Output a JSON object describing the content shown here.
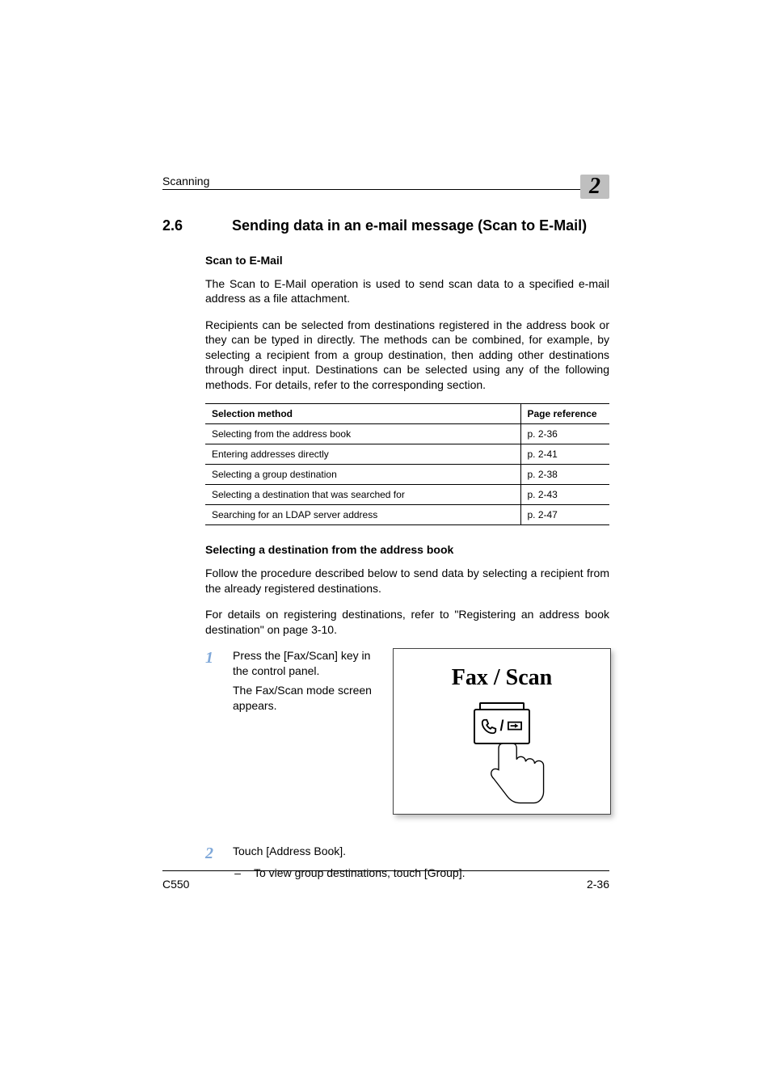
{
  "running_header": {
    "text": "Scanning",
    "chapter_number": "2"
  },
  "section": {
    "number": "2.6",
    "title": "Sending data in an e-mail message (Scan to E-Mail)"
  },
  "subsection1": {
    "heading": "Scan to E-Mail",
    "para1": "The Scan to E-Mail operation is used to send scan data to a specified e-mail address as a file attachment.",
    "para2": "Recipients can be selected from destinations registered in the address book or they can be typed in directly. The methods can be combined, for example, by selecting a recipient from a group destination, then adding other destinations through direct input. Destinations can be selected using any of the following methods. For details, refer to the corresponding section."
  },
  "table": {
    "header": {
      "col1": "Selection method",
      "col2": "Page reference"
    },
    "rows": [
      {
        "method": "Selecting from the address book",
        "page": "p. 2-36"
      },
      {
        "method": "Entering addresses directly",
        "page": "p. 2-41"
      },
      {
        "method": "Selecting a group destination",
        "page": "p. 2-38"
      },
      {
        "method": "Selecting a destination that was searched for",
        "page": "p. 2-43"
      },
      {
        "method": "Searching for an LDAP server address",
        "page": "p. 2-47"
      }
    ]
  },
  "subsection2": {
    "heading": "Selecting a destination from the address book",
    "para1": "Follow the procedure described below to send data by selecting a recipient from the already registered destinations.",
    "para2": "For details on registering destinations, refer to \"Registering an address book destination\" on page 3-10."
  },
  "steps": {
    "s1_num": "1",
    "s1_line1": "Press the [Fax/Scan] key in the control panel.",
    "s1_line2": "The Fax/Scan mode screen appears.",
    "illustration_title": "Fax / Scan",
    "s2_num": "2",
    "s2_text": "Touch [Address Book].",
    "s2_sub_dash": "–",
    "s2_sub_text": "To view group destinations, touch [Group]."
  },
  "footer": {
    "model": "C550",
    "page": "2-36"
  }
}
